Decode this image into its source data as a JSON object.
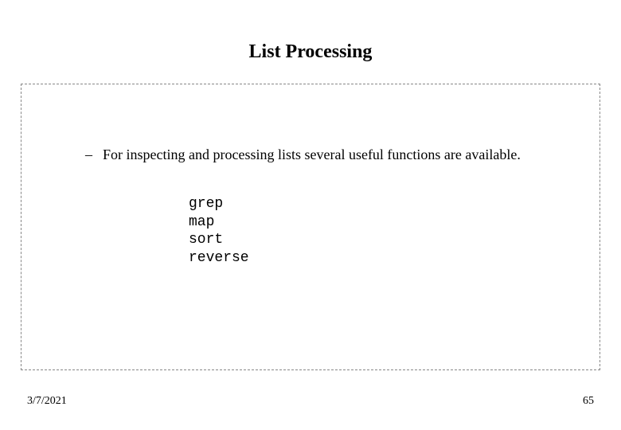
{
  "title": "List Processing",
  "bullet": {
    "dash": "–",
    "text": "For inspecting and processing lists several useful functions are available."
  },
  "functions": [
    "grep",
    "map",
    "sort",
    "reverse"
  ],
  "footer": {
    "date": "3/7/2021",
    "page": "65"
  }
}
